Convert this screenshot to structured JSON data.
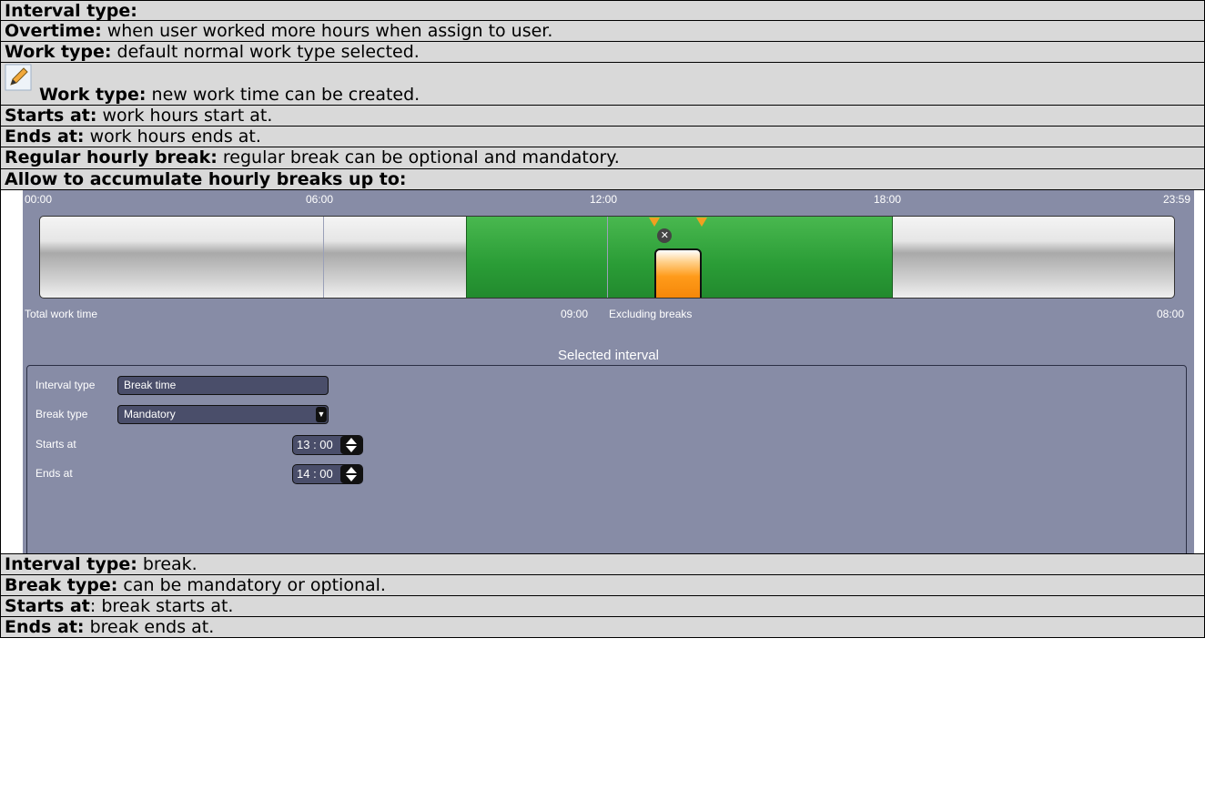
{
  "rows_top": [
    {
      "bold": "Interval type:",
      "text": ""
    },
    {
      "bold": "Overtime:",
      "text": " when user worked more hours when assign to user."
    },
    {
      "bold": "Work type:",
      "text": " default normal work type selected."
    },
    {
      "bold": "Work type:",
      "text": " new work time can be created.",
      "icon": "edit-pencil-icon"
    },
    {
      "bold": "Starts at:",
      "text": " work hours start at."
    },
    {
      "bold": "Ends at:",
      "text": " work hours ends at."
    },
    {
      "bold": "Regular hourly break:",
      "text": " regular break can be optional and mandatory."
    },
    {
      "bold": "Allow to accumulate hourly breaks up to:",
      "text": ""
    }
  ],
  "timeline": {
    "ticks": [
      "00:00",
      "06:00",
      "12:00",
      "18:00",
      "23:59"
    ],
    "work_interval": {
      "start": "09:00",
      "end": "18:00"
    },
    "break_interval": {
      "start": "13:00",
      "end": "14:00"
    },
    "total_work_label": "Total work time",
    "total_work_value": "09:00",
    "excluding_label": "Excluding breaks",
    "excluding_value": "08:00",
    "colors": {
      "work": "#2a9c36",
      "break": "#f07d00",
      "background": "#878ca6"
    }
  },
  "selected": {
    "title": "Selected interval",
    "interval_type_label": "Interval type",
    "interval_type_value": "Break time",
    "break_type_label": "Break type",
    "break_type_value": "Mandatory",
    "starts_label": "Starts at",
    "starts_value": "13 : 00",
    "ends_label": "Ends at",
    "ends_value": "14 : 00"
  },
  "rows_bottom": [
    {
      "bold": "Interval type:",
      "text": " break."
    },
    {
      "bold": "Break type:",
      "text": " can be mandatory or optional."
    },
    {
      "bold": "Starts at",
      "text": ": break starts at."
    },
    {
      "bold": "Ends at:",
      "text": " break ends at."
    }
  ]
}
